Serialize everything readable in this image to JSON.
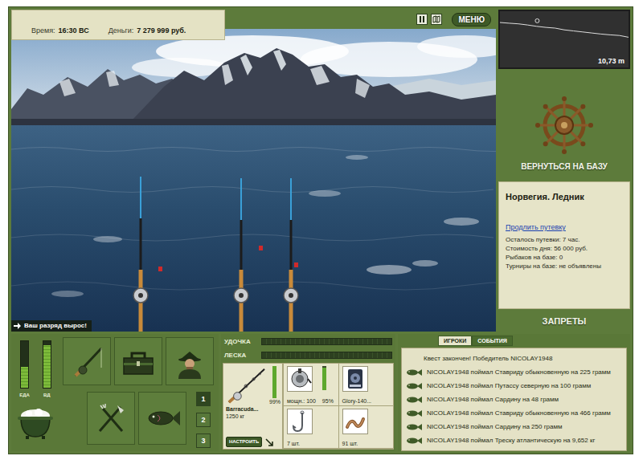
{
  "status": {
    "time_label": "Время:",
    "time": "16:30 ВС",
    "money_label": "Деньги:",
    "money": "7 279 999 руб."
  },
  "menu": {
    "label": "МЕНЮ"
  },
  "scene": {
    "notice": "Ваш разряд вырос!"
  },
  "depth": {
    "reading": "10,73 m",
    "marker": 0.29,
    "profile": [
      7.2,
      7.4,
      7.6,
      7.9,
      8.3,
      8.6,
      8.8,
      9.3,
      9.6,
      9.9,
      10.2,
      10.5,
      10.73,
      10.9,
      11.4
    ]
  },
  "base_button": "ВЕРНУТЬСЯ НА БАЗУ",
  "location": {
    "title": "Норвегия. Ледник",
    "extend_link": "Продлить путевку",
    "lines": [
      "Осталось путевки: 7 час.",
      "Стоимость дня: 56 000 руб.",
      "Рыбаков на базе: 0",
      "Турниры на базе: не объявлены"
    ]
  },
  "bans_button": "ЗАПРЕТЫ",
  "needs": [
    {
      "label": "ЕДА",
      "level": 0.45
    },
    {
      "label": "ВД",
      "level": 0.92
    }
  ],
  "slots": [
    {
      "label": "1",
      "selected": true
    },
    {
      "label": "2",
      "selected": false
    },
    {
      "label": "3",
      "selected": false
    }
  ],
  "tension": [
    {
      "label": "УДОЧКА",
      "level": 0
    },
    {
      "label": "ЛЕСКА",
      "level": 0
    }
  ],
  "rod": {
    "name": "Barracuda...",
    "capacity": "1250 кг",
    "condition": "99%",
    "level": 0.99,
    "setup_button": "НАСТРОИТЬ"
  },
  "items": [
    {
      "kind": "reel",
      "caption": "мощн.: 100",
      "condition": "95%",
      "level": 0.95
    },
    {
      "kind": "line",
      "caption": "Glory-140..."
    },
    {
      "kind": "hook",
      "caption": "7 шт."
    },
    {
      "kind": "bait",
      "caption": "91 шт."
    }
  ],
  "feed_tabs": [
    {
      "label": "ИГРОКИ",
      "selected": true
    },
    {
      "label": "СОБЫТИЯ",
      "selected": false
    }
  ],
  "feed": [
    {
      "kind": "notice",
      "text": "Квест закончен! Победитель NICOLAY1948"
    },
    {
      "kind": "catch",
      "text": "NICOLAY1948 поймал Ставриду обыкновенную на 225 грамм"
    },
    {
      "kind": "catch",
      "text": "NICOLAY1948 поймал Путассу северную на 100 грамм"
    },
    {
      "kind": "catch",
      "text": "NICOLAY1948 поймал Сардину на 48 грамм"
    },
    {
      "kind": "catch",
      "text": "NICOLAY1948 поймал Ставриду обыкновенную на 466 грамм"
    },
    {
      "kind": "catch",
      "text": "NICOLAY1948 поймал Сардину на 250 грамм"
    },
    {
      "kind": "catch",
      "text": "NICOLAY1948 поймал Треску атлантическую на 9,652 кг"
    }
  ]
}
